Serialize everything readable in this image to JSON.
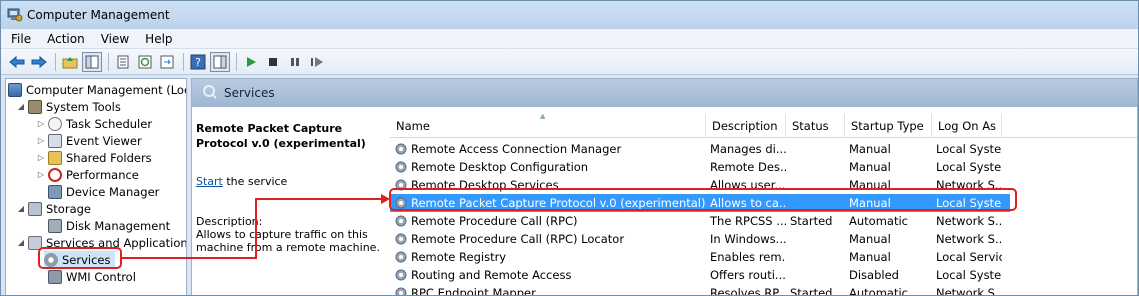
{
  "window": {
    "title": "Computer Management"
  },
  "menu": [
    "File",
    "Action",
    "View",
    "Help"
  ],
  "tree": {
    "root": "Computer Management (Local",
    "items": [
      {
        "label": "System Tools",
        "icon": "tools-icon"
      },
      {
        "label": "Task Scheduler",
        "icon": "clock-icon"
      },
      {
        "label": "Event Viewer",
        "icon": "event-viewer-icon"
      },
      {
        "label": "Shared Folders",
        "icon": "shared-folders-icon"
      },
      {
        "label": "Performance",
        "icon": "performance-icon"
      },
      {
        "label": "Device Manager",
        "icon": "device-manager-icon"
      },
      {
        "label": "Storage",
        "icon": "storage-icon"
      },
      {
        "label": "Disk Management",
        "icon": "disk-icon"
      },
      {
        "label": "Services and Applications",
        "icon": "services-apps-icon"
      },
      {
        "label": "Services",
        "icon": "services-gear-icon"
      },
      {
        "label": "WMI Control",
        "icon": "wmi-icon"
      }
    ]
  },
  "panel": {
    "title": "Services"
  },
  "description": {
    "name": "Remote Packet Capture Protocol v.0 (experimental)",
    "start_link": "Start",
    "start_rest": " the service",
    "label": "Description:",
    "text": "Allows to capture traffic on this machine from a remote machine."
  },
  "columns": [
    "Name",
    "Description",
    "Status",
    "Startup Type",
    "Log On As"
  ],
  "rows": [
    {
      "name": "Remote Access Connection Manager",
      "desc": "Manages di...",
      "status": "",
      "startup": "Manual",
      "logon": "Local Syste..."
    },
    {
      "name": "Remote Desktop Configuration",
      "desc": "Remote Des...",
      "status": "",
      "startup": "Manual",
      "logon": "Local Syste..."
    },
    {
      "name": "Remote Desktop Services",
      "desc": "Allows user...",
      "status": "",
      "startup": "Manual",
      "logon": "Network S..."
    },
    {
      "name": "Remote Packet Capture Protocol v.0 (experimental)",
      "desc": "Allows to ca...",
      "status": "",
      "startup": "Manual",
      "logon": "Local Syste..."
    },
    {
      "name": "Remote Procedure Call (RPC)",
      "desc": "The RPCSS ...",
      "status": "Started",
      "startup": "Automatic",
      "logon": "Network S..."
    },
    {
      "name": "Remote Procedure Call (RPC) Locator",
      "desc": "In Windows...",
      "status": "",
      "startup": "Manual",
      "logon": "Network S..."
    },
    {
      "name": "Remote Registry",
      "desc": "Enables rem...",
      "status": "",
      "startup": "Manual",
      "logon": "Local Service"
    },
    {
      "name": "Routing and Remote Access",
      "desc": "Offers routi...",
      "status": "",
      "startup": "Disabled",
      "logon": "Local Syste..."
    },
    {
      "name": "RPC Endpoint Mapper",
      "desc": "Resolves RP...",
      "status": "Started",
      "startup": "Automatic",
      "logon": "Network S..."
    }
  ],
  "selected_row": "Remote Packet Capture Protocol v.0 (experimental)",
  "colors": {
    "selection": "#3399ff",
    "callout": "#e02020",
    "panel_header": "#a9bfd9"
  }
}
